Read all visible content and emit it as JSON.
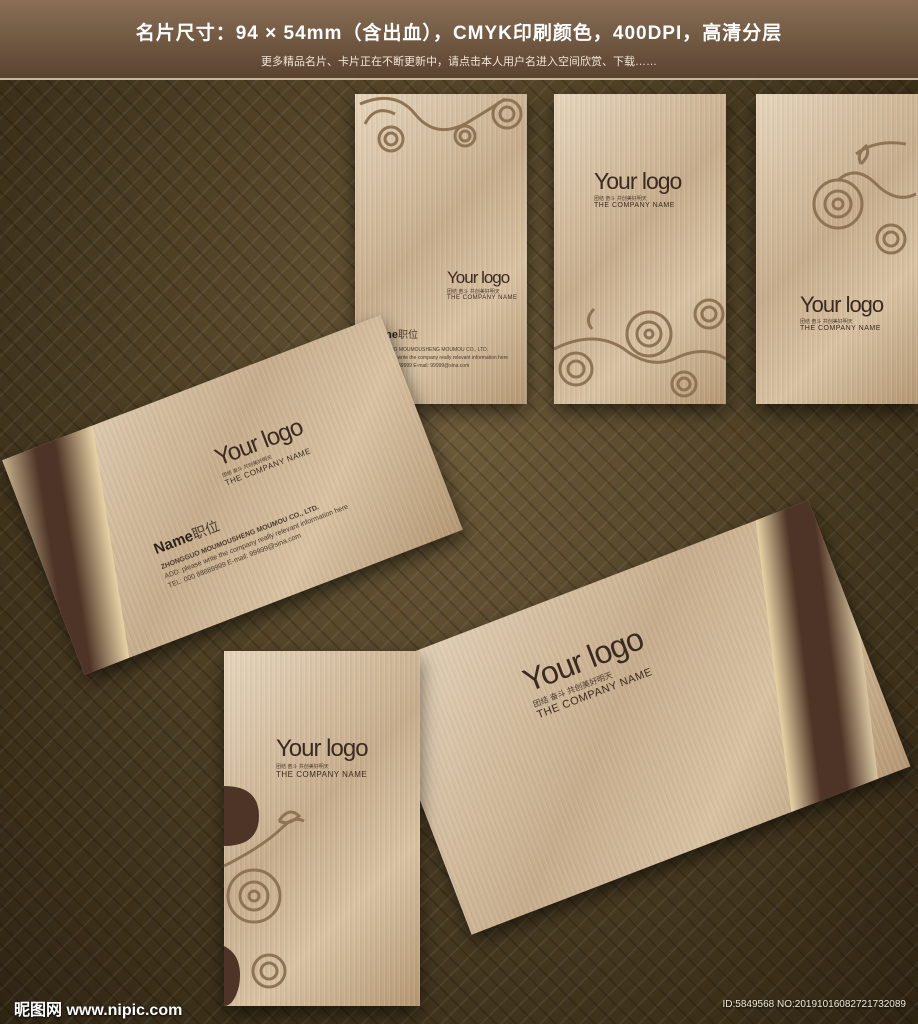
{
  "header": {
    "title": "名片尺寸：94 × 54mm（含出血），CMYK印刷颜色，400DPI，高清分层",
    "subtitle": "更多精品名片、卡片正在不断更新中，请点击本人用户名进入空间欣赏、下载……"
  },
  "card": {
    "logo": "Your logo",
    "slogan": "团结 奋斗 共创美好明天",
    "company": "THE COMPANY NAME",
    "name": "Name",
    "position": "职位",
    "company_full": "ZHONGGUO MOUMOUSHENG MOUMOU CO., LTD.",
    "address": "ADD: please write the company really relevant information here",
    "contact": "TEL: 000 88889999    E-mail: 99999@sina.com",
    "contact_small": "TEL: 000 88889999    E-mail: 99999@sina.com"
  },
  "footer": {
    "watermark": "昵图网 www.nipic.com",
    "id_text": "ID:5849568 NO:20191016082721732089"
  },
  "colors": {
    "brown_dark": "#4e3426",
    "gold": "#e8d3a6",
    "bronze": "#8a6f55"
  }
}
